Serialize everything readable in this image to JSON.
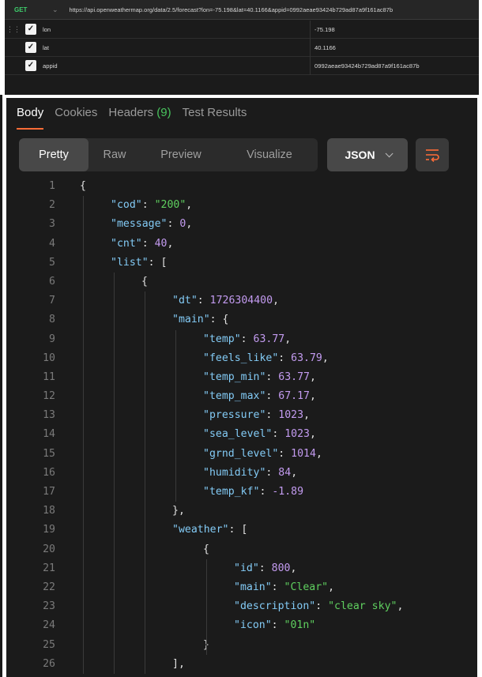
{
  "request": {
    "method": "GET",
    "url": "https://api.openweathermap.org/data/2.5/forecast?lon=-75.198&lat=40.1166&appid=0992aeae93424b729ad87a9f161ac87b"
  },
  "params": [
    {
      "key": "lon",
      "value": "-75.198"
    },
    {
      "key": "lat",
      "value": "40.1166"
    },
    {
      "key": "appid",
      "value": "0992aeae93424b729ad87a9f161ac87b"
    }
  ],
  "response_tabs": {
    "body": "Body",
    "cookies": "Cookies",
    "headers": "Headers",
    "headers_count": "(9)",
    "test_results": "Test Results"
  },
  "view_modes": [
    "Pretty",
    "Raw",
    "Preview",
    "Visualize"
  ],
  "format": "JSON",
  "colors": {
    "key": "#83cbf6",
    "string": "#5fd05f",
    "number": "#c39bf0",
    "accent": "#ff6c37"
  },
  "code_lines": [
    {
      "num": "1",
      "indent": 0,
      "tokens": [
        [
          "p",
          "{"
        ]
      ]
    },
    {
      "num": "2",
      "indent": 1,
      "tokens": [
        [
          "k",
          "\"cod\""
        ],
        [
          "p",
          ": "
        ],
        [
          "s",
          "\"200\""
        ],
        [
          "p",
          ","
        ]
      ]
    },
    {
      "num": "3",
      "indent": 1,
      "tokens": [
        [
          "k",
          "\"message\""
        ],
        [
          "p",
          ": "
        ],
        [
          "n",
          "0"
        ],
        [
          "p",
          ","
        ]
      ]
    },
    {
      "num": "4",
      "indent": 1,
      "tokens": [
        [
          "k",
          "\"cnt\""
        ],
        [
          "p",
          ": "
        ],
        [
          "n",
          "40"
        ],
        [
          "p",
          ","
        ]
      ]
    },
    {
      "num": "5",
      "indent": 1,
      "tokens": [
        [
          "k",
          "\"list\""
        ],
        [
          "p",
          ": ["
        ]
      ]
    },
    {
      "num": "6",
      "indent": 2,
      "tokens": [
        [
          "p",
          "{"
        ]
      ]
    },
    {
      "num": "7",
      "indent": 3,
      "tokens": [
        [
          "k",
          "\"dt\""
        ],
        [
          "p",
          ": "
        ],
        [
          "n",
          "1726304400"
        ],
        [
          "p",
          ","
        ]
      ]
    },
    {
      "num": "8",
      "indent": 3,
      "tokens": [
        [
          "k",
          "\"main\""
        ],
        [
          "p",
          ": {"
        ]
      ]
    },
    {
      "num": "9",
      "indent": 4,
      "tokens": [
        [
          "k",
          "\"temp\""
        ],
        [
          "p",
          ": "
        ],
        [
          "n",
          "63.77"
        ],
        [
          "p",
          ","
        ]
      ]
    },
    {
      "num": "10",
      "indent": 4,
      "tokens": [
        [
          "k",
          "\"feels_like\""
        ],
        [
          "p",
          ": "
        ],
        [
          "n",
          "63.79"
        ],
        [
          "p",
          ","
        ]
      ]
    },
    {
      "num": "11",
      "indent": 4,
      "tokens": [
        [
          "k",
          "\"temp_min\""
        ],
        [
          "p",
          ": "
        ],
        [
          "n",
          "63.77"
        ],
        [
          "p",
          ","
        ]
      ]
    },
    {
      "num": "12",
      "indent": 4,
      "tokens": [
        [
          "k",
          "\"temp_max\""
        ],
        [
          "p",
          ": "
        ],
        [
          "n",
          "67.17"
        ],
        [
          "p",
          ","
        ]
      ]
    },
    {
      "num": "13",
      "indent": 4,
      "tokens": [
        [
          "k",
          "\"pressure\""
        ],
        [
          "p",
          ": "
        ],
        [
          "n",
          "1023"
        ],
        [
          "p",
          ","
        ]
      ]
    },
    {
      "num": "14",
      "indent": 4,
      "tokens": [
        [
          "k",
          "\"sea_level\""
        ],
        [
          "p",
          ": "
        ],
        [
          "n",
          "1023"
        ],
        [
          "p",
          ","
        ]
      ]
    },
    {
      "num": "15",
      "indent": 4,
      "tokens": [
        [
          "k",
          "\"grnd_level\""
        ],
        [
          "p",
          ": "
        ],
        [
          "n",
          "1014"
        ],
        [
          "p",
          ","
        ]
      ]
    },
    {
      "num": "16",
      "indent": 4,
      "tokens": [
        [
          "k",
          "\"humidity\""
        ],
        [
          "p",
          ": "
        ],
        [
          "n",
          "84"
        ],
        [
          "p",
          ","
        ]
      ]
    },
    {
      "num": "17",
      "indent": 4,
      "tokens": [
        [
          "k",
          "\"temp_kf\""
        ],
        [
          "p",
          ": "
        ],
        [
          "n",
          "-1.89"
        ]
      ]
    },
    {
      "num": "18",
      "indent": 3,
      "tokens": [
        [
          "p",
          "},"
        ]
      ]
    },
    {
      "num": "19",
      "indent": 3,
      "tokens": [
        [
          "k",
          "\"weather\""
        ],
        [
          "p",
          ": ["
        ]
      ]
    },
    {
      "num": "20",
      "indent": 4,
      "tokens": [
        [
          "p",
          "{"
        ]
      ]
    },
    {
      "num": "21",
      "indent": 5,
      "tokens": [
        [
          "k",
          "\"id\""
        ],
        [
          "p",
          ": "
        ],
        [
          "n",
          "800"
        ],
        [
          "p",
          ","
        ]
      ]
    },
    {
      "num": "22",
      "indent": 5,
      "tokens": [
        [
          "k",
          "\"main\""
        ],
        [
          "p",
          ": "
        ],
        [
          "s",
          "\"Clear\""
        ],
        [
          "p",
          ","
        ]
      ]
    },
    {
      "num": "23",
      "indent": 5,
      "tokens": [
        [
          "k",
          "\"description\""
        ],
        [
          "p",
          ": "
        ],
        [
          "s",
          "\"clear sky\""
        ],
        [
          "p",
          ","
        ]
      ]
    },
    {
      "num": "24",
      "indent": 5,
      "tokens": [
        [
          "k",
          "\"icon\""
        ],
        [
          "p",
          ": "
        ],
        [
          "s",
          "\"01n\""
        ]
      ]
    },
    {
      "num": "25",
      "indent": 4,
      "tokens": [
        [
          "p",
          "}"
        ]
      ]
    },
    {
      "num": "26",
      "indent": 3,
      "tokens": [
        [
          "p",
          "],"
        ]
      ]
    }
  ]
}
